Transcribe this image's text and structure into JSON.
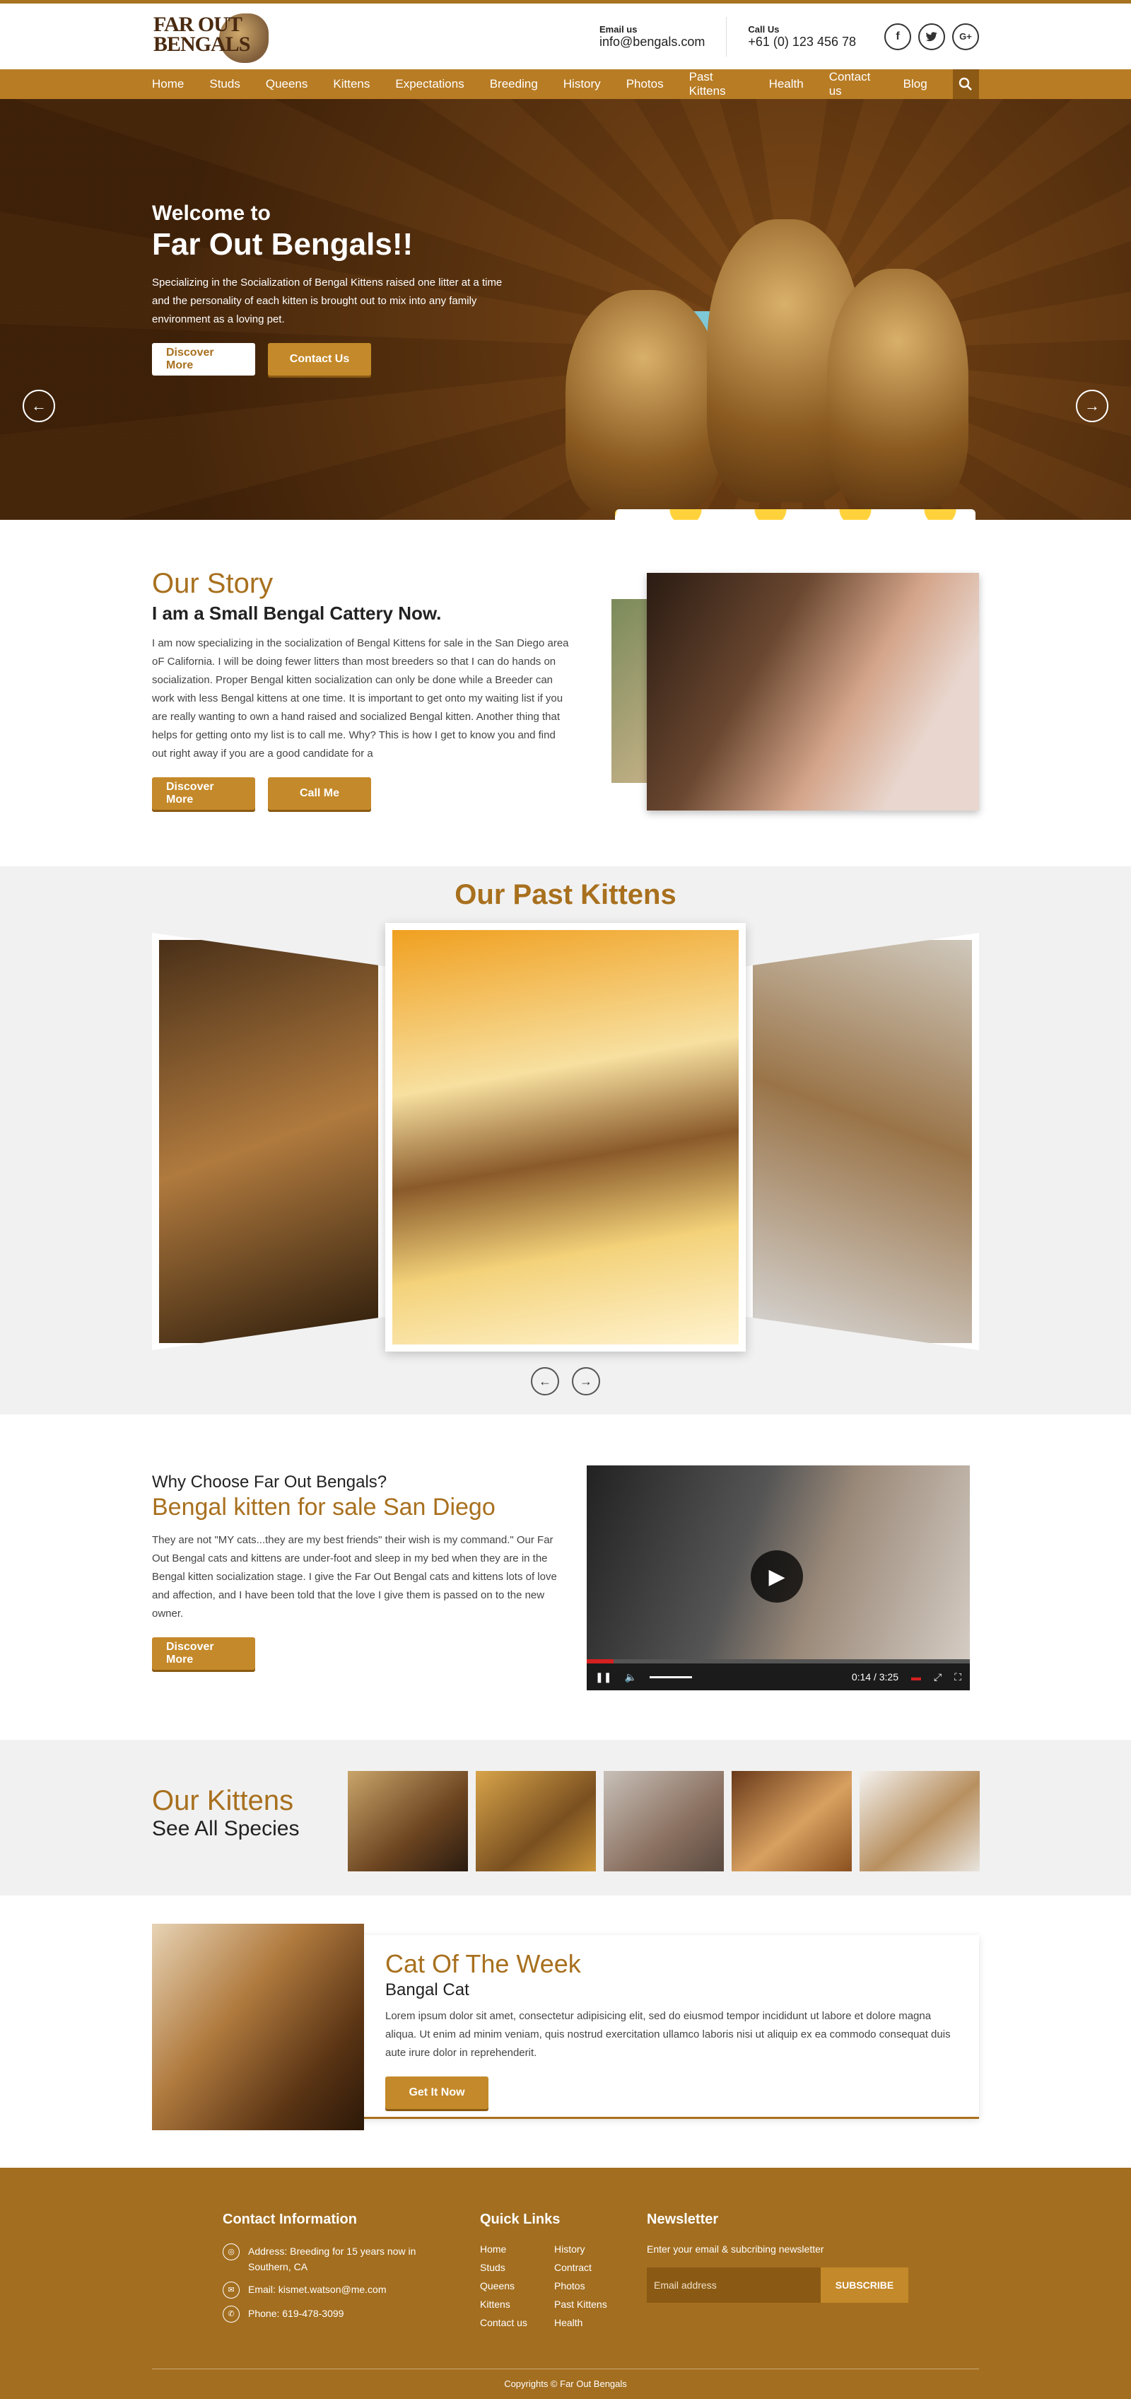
{
  "header": {
    "logo_text": "FAR OUT BENGALS",
    "email_label": "Email us",
    "email_value": "info@bengals.com",
    "phone_label": "Call Us",
    "phone_value": "+61 (0) 123 456 78",
    "socials": [
      "f",
      "t",
      "G+"
    ]
  },
  "nav": {
    "items": [
      "Home",
      "Studs",
      "Queens",
      "Kittens",
      "Expectations",
      "Breeding",
      "History",
      "Photos",
      "Past Kittens",
      "Health",
      "Contact us",
      "Blog"
    ],
    "search_icon": "magnifier-icon"
  },
  "hero": {
    "welcome": "Welcome to",
    "title": "Far Out Bengals!!",
    "text": "Specializing in the Socialization of Bengal Kittens raised one litter at a time and the personality of each kitten is brought out to mix into any family environment as a loving pet.",
    "btn_discover": "Discover More",
    "btn_contact": "Contact Us",
    "prev": "←",
    "next": "→"
  },
  "story": {
    "title": "Our Story",
    "subtitle": "I am a Small Bengal Cattery Now.",
    "text": "I am now specializing in the socialization of Bengal Kittens for sale in the San Diego area oF California. I will be doing fewer litters than most breeders so that I can do hands on socialization. Proper Bengal kitten socialization can only be done while a Breeder can work with less Bengal kittens at one time. It is important to get onto my waiting list if you are really wanting to own a hand raised and socialized Bengal kitten. Another thing that helps for getting onto my list is to call me. Why? This is how I get to know you and find out right away if you are a good candidate for a",
    "btn_discover": "Discover More",
    "btn_call": "Call Me"
  },
  "past": {
    "title": "Our Past Kittens",
    "prev": "←",
    "next": "→"
  },
  "why": {
    "kicker": "Why Choose Far Out Bengals?",
    "title": "Bengal kitten for sale San Diego",
    "text": "They are not \"MY cats...they are my best friends\" their wish is my command.\" Our Far Out Bengal cats and kittens are under-foot and sleep in my bed when they are in the Bengal kitten socialization stage. I give the Far Out Bengal cats and kittens lots of love and affection, and I have been told that the love I give them is passed on to the new owner.",
    "btn_discover": "Discover More",
    "video_time": "0:14 / 3:25",
    "video_progress": 0.07
  },
  "kittens": {
    "title": "Our Kittens",
    "subtitle": "See All Species"
  },
  "cotw": {
    "title": "Cat Of The Week",
    "subtitle": "Bangal Cat",
    "text": "Lorem ipsum dolor sit amet, consectetur adipisicing elit, sed do eiusmod tempor incididunt ut labore et dolore magna aliqua. Ut enim ad minim veniam, quis nostrud exercitation ullamco laboris nisi ut aliquip ex ea commodo consequat duis aute irure dolor in reprehenderit.",
    "btn": "Get It Now"
  },
  "footer": {
    "contact_title": "Contact Information",
    "address": "Address: Breeding for 15 years now in Southern, CA",
    "email": "Email: kismet.watson@me.com",
    "phone": "Phone:  619-478-3099",
    "links_title": "Quick Links",
    "links": [
      "Home",
      "History",
      "Studs",
      "Contract",
      "Queens",
      "Photos",
      "Kittens",
      "Past Kittens",
      "Contact us",
      "Health"
    ],
    "news_title": "Newsletter",
    "news_text": "Enter your email & subcribing newsletter",
    "news_placeholder": "Email address",
    "subscribe": "SUBSCRIBE",
    "copyright": "Copyrights © Far Out Bengals"
  },
  "colors": {
    "gold": "#a8701e",
    "nav": "#b87c24",
    "footer": "#a36e1f",
    "light_bg": "#f1f1f1"
  }
}
